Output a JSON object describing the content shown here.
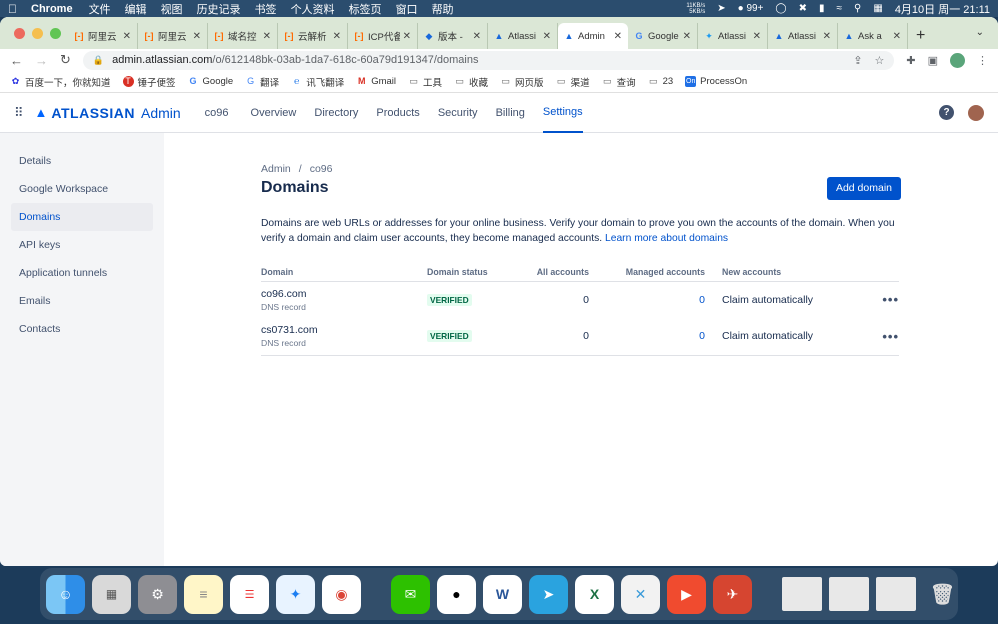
{
  "menubar": {
    "app_name": "Chrome",
    "menus": [
      "文件",
      "编辑",
      "视图",
      "历史记录",
      "书签",
      "个人资料",
      "标签页",
      "窗口",
      "帮助"
    ],
    "net_up": "11KB/s",
    "net_down": "5KB/s",
    "notif_count": "99+",
    "datetime": "4月10日 周一 21:11"
  },
  "browser": {
    "tabs": [
      {
        "title": "阿里云",
        "icon": "aliyun-icon"
      },
      {
        "title": "阿里云",
        "icon": "aliyun-icon"
      },
      {
        "title": "域名控",
        "icon": "aliyun-icon"
      },
      {
        "title": "云解析",
        "icon": "aliyun-icon"
      },
      {
        "title": "ICP代备",
        "icon": "aliyun-icon"
      },
      {
        "title": "版本 -",
        "icon": "jira-icon"
      },
      {
        "title": "Atlassi",
        "icon": "atlassian-icon"
      },
      {
        "title": "Admin",
        "icon": "atlassian-icon"
      },
      {
        "title": "Google",
        "icon": "google-icon"
      },
      {
        "title": "Atlassi",
        "icon": "twitter-icon"
      },
      {
        "title": "Atlassi",
        "icon": "atlassian-icon"
      },
      {
        "title": "Ask a",
        "icon": "atlassian-icon"
      }
    ],
    "active_tab": 7,
    "url_host": "admin.atlassian.com",
    "url_path": "/o/612148bk-03ab-1da7-618c-60a79d191347/domains",
    "bookmarks": [
      "百度一下，你就知道",
      "锤子便签",
      "Google",
      "翻译",
      "讯飞翻译",
      "Gmail",
      "工具",
      "收藏",
      "网页版",
      "渠道",
      "查询",
      "23",
      "ProcessOn"
    ]
  },
  "header": {
    "brand": "ATLASSIAN",
    "product": "Admin",
    "org": "co96",
    "nav": [
      "Overview",
      "Directory",
      "Products",
      "Security",
      "Billing",
      "Settings"
    ],
    "active_nav": "Settings"
  },
  "sidebar": {
    "items": [
      "Details",
      "Google Workspace",
      "Domains",
      "API keys",
      "Application tunnels",
      "Emails",
      "Contacts"
    ],
    "active": "Domains"
  },
  "main": {
    "breadcrumb": [
      "Admin",
      "co96"
    ],
    "breadcrumb_sep": "/",
    "title": "Domains",
    "add_button": "Add domain",
    "description": "Domains are web URLs or addresses for your online business. Verify your domain to prove you own the accounts of the domain. When you verify a domain and claim user accounts, they become managed accounts.",
    "learn_more": "Learn more about domains",
    "table": {
      "headers": [
        "Domain",
        "Domain status",
        "All accounts",
        "Managed accounts",
        "New accounts"
      ],
      "rows": [
        {
          "domain": "co96.com",
          "sub": "DNS record",
          "status": "VERIFIED",
          "all": "0",
          "managed": "0",
          "new": "Claim automatically"
        },
        {
          "domain": "cs0731.com",
          "sub": "DNS record",
          "status": "VERIFIED",
          "all": "0",
          "managed": "0",
          "new": "Claim automatically"
        }
      ]
    }
  }
}
